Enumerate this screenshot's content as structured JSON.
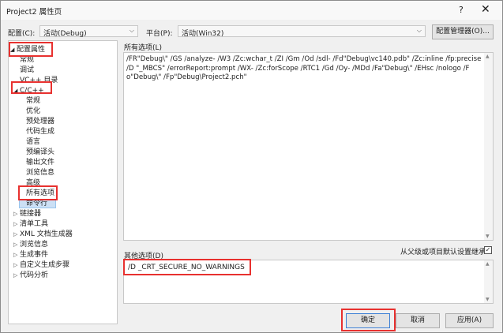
{
  "window": {
    "title": "Project2 属性页",
    "help": "?",
    "close": "✕"
  },
  "toolbar": {
    "config_label": "配置(C):",
    "config_value": "活动(Debug)",
    "platform_label": "平台(P):",
    "platform_value": "活动(Win32)",
    "config_manager": "配置管理器(O)..."
  },
  "tree": [
    {
      "label": "配置属性",
      "arrow": "◢",
      "indent": 0
    },
    {
      "label": "常规",
      "arrow": "",
      "indent": 1
    },
    {
      "label": "调试",
      "arrow": "",
      "indent": 1
    },
    {
      "label": "VC++ 目录",
      "arrow": "",
      "indent": 1
    },
    {
      "label": "C/C++",
      "arrow": "◢",
      "indent": 1
    },
    {
      "label": "常规",
      "arrow": "",
      "indent": 2
    },
    {
      "label": "优化",
      "arrow": "",
      "indent": 2
    },
    {
      "label": "预处理器",
      "arrow": "",
      "indent": 2
    },
    {
      "label": "代码生成",
      "arrow": "",
      "indent": 2
    },
    {
      "label": "语言",
      "arrow": "",
      "indent": 2
    },
    {
      "label": "预编译头",
      "arrow": "",
      "indent": 2
    },
    {
      "label": "输出文件",
      "arrow": "",
      "indent": 2
    },
    {
      "label": "浏览信息",
      "arrow": "",
      "indent": 2
    },
    {
      "label": "高级",
      "arrow": "",
      "indent": 2
    },
    {
      "label": "所有选项",
      "arrow": "",
      "indent": 2
    },
    {
      "label": "命令行",
      "arrow": "",
      "indent": 2,
      "selected": true
    },
    {
      "label": "链接器",
      "arrow": "▷",
      "indent": 1
    },
    {
      "label": "清单工具",
      "arrow": "▷",
      "indent": 1
    },
    {
      "label": "XML 文档生成器",
      "arrow": "▷",
      "indent": 1
    },
    {
      "label": "浏览信息",
      "arrow": "▷",
      "indent": 1
    },
    {
      "label": "生成事件",
      "arrow": "▷",
      "indent": 1
    },
    {
      "label": "自定义生成步骤",
      "arrow": "▷",
      "indent": 1
    },
    {
      "label": "代码分析",
      "arrow": "▷",
      "indent": 1
    }
  ],
  "all_options": {
    "label": "所有选项(L)",
    "text": "/FR\"Debug\\\" /GS /analyze- /W3 /Zc:wchar_t /ZI /Gm /Od /sdl- /Fd\"Debug\\vc140.pdb\" /Zc:inline /fp:precise /D \"_MBCS\" /errorReport:prompt /WX- /Zc:forScope /RTC1 /Gd /Oy- /MDd /Fa\"Debug\\\" /EHsc /nologo /Fo\"Debug\\\" /Fp\"Debug\\Project2.pch\""
  },
  "other_options": {
    "label": "其他选项(D)",
    "inherit_label": "从父级或项目默认设置继承",
    "inherit_checked": true,
    "value": "/D _CRT_SECURE_NO_WARNINGS"
  },
  "buttons": {
    "ok": "确定",
    "cancel": "取消",
    "apply": "应用(A)"
  }
}
